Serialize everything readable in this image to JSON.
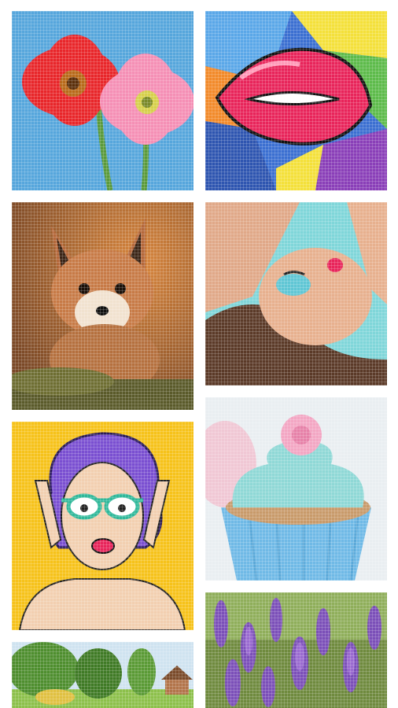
{
  "gallery": {
    "tiles": [
      {
        "id": "flowers",
        "subject": "flowers-image",
        "colors": {
          "sky": "#56a6dc",
          "red": "#e8262a",
          "pink": "#f58fb5",
          "stem": "#5a9a3a"
        }
      },
      {
        "id": "popart",
        "subject": "pop-art-lips-image",
        "colors": {
          "lips": "#e8245a",
          "yellow": "#f4e03a",
          "blue": "#3b6fd1",
          "green": "#5dbb4a",
          "orange": "#f28a2a"
        }
      },
      {
        "id": "fox",
        "subject": "fox-cub-image",
        "colors": {
          "bg": "#a8643a",
          "fur": "#c77a46",
          "moss": "#5a5a2a"
        }
      },
      {
        "id": "woman",
        "subject": "woman-portrait-image",
        "colors": {
          "bg": "#7fd6d9",
          "skin": "#e7b08e",
          "hair": "#5b3a28"
        }
      },
      {
        "id": "popgirl",
        "subject": "pop-art-girl-image",
        "colors": {
          "bg": "#f6c21a",
          "hair": "#7a4fd1",
          "skin": "#f2cfb0",
          "glasses": "#2fb89a"
        }
      },
      {
        "id": "cupcake",
        "subject": "cupcake-image",
        "colors": {
          "bg": "#e9eef1",
          "frosting": "#8fd8d6",
          "cup": "#6fb9e6",
          "rose": "#f3a6c3"
        }
      },
      {
        "id": "landscape",
        "subject": "landscape-image",
        "colors": {
          "sky": "#cfe3f0",
          "trees": "#4e8e2e",
          "grass": "#8cc04a"
        }
      },
      {
        "id": "lavender",
        "subject": "lavender-image",
        "colors": {
          "bg": "#6f8a3e",
          "flower": "#7b4fb8"
        }
      }
    ]
  }
}
